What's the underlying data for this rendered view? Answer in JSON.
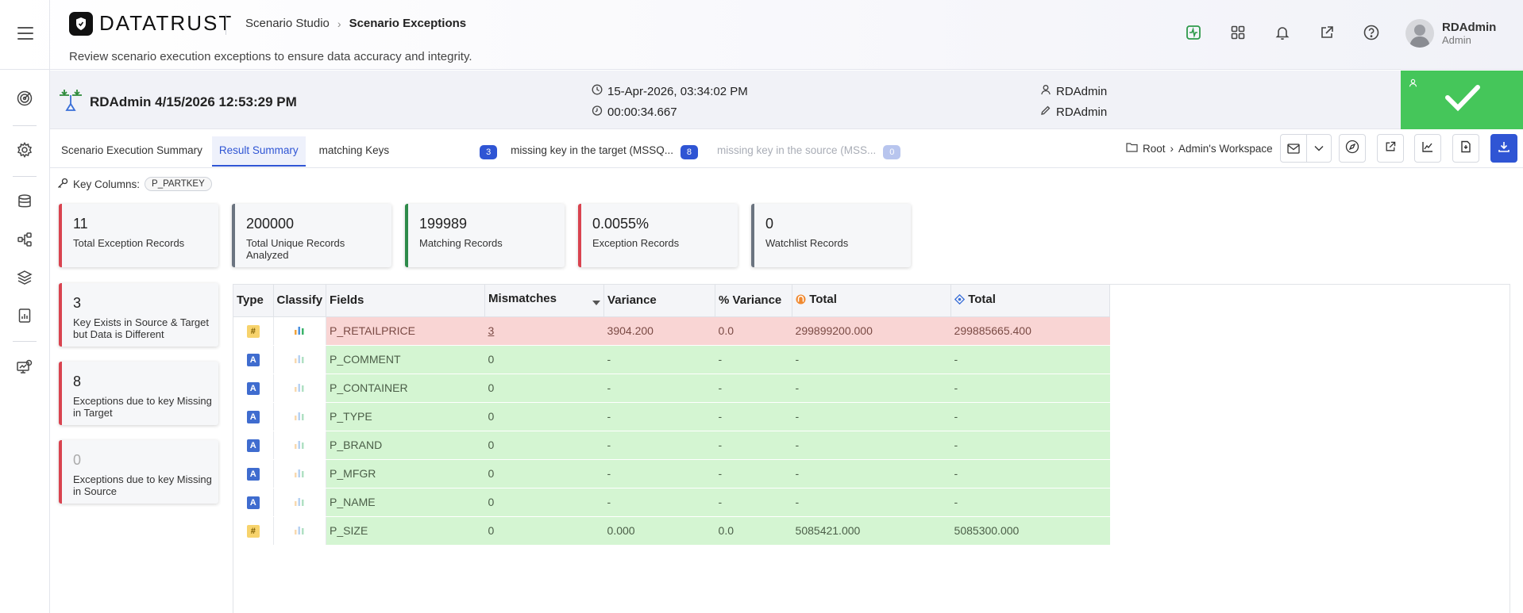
{
  "header": {
    "logo_text": "DATATRUST",
    "breadcrumb": [
      "Scenario Studio",
      "Scenario Exceptions"
    ],
    "subtitle": "Review scenario execution exceptions to ensure data accuracy and integrity.",
    "icons": [
      "activity-icon",
      "apps-grid-icon",
      "bell-icon",
      "external-link-icon",
      "help-icon"
    ],
    "user": {
      "name": "RDAdmin",
      "role": "Admin"
    }
  },
  "sidebar": {
    "icons": [
      "target-icon",
      "settings-icon",
      "database-icon",
      "workflow-icon",
      "layers-icon",
      "report-icon",
      "monitor-settings-icon"
    ]
  },
  "scenario": {
    "title": "RDAdmin 4/15/2026 12:53:29 PM",
    "run_datetime": "15-Apr-2026, 03:34:02 PM",
    "duration": "00:00:34.667",
    "owner": "RDAdmin",
    "editor": "RDAdmin",
    "status": "success"
  },
  "tabs": {
    "summary": "Scenario Execution Summary",
    "result": "Result Summary",
    "matching": "matching Keys",
    "matching_count": "3",
    "missing_target": "missing key in the target (MSSQ...",
    "missing_target_count": "8",
    "missing_source": "missing key in the source (MSS...",
    "missing_source_count": "0"
  },
  "path": {
    "root": "Root",
    "workspace": "Admin's Workspace"
  },
  "key_columns": {
    "label": "Key Columns:",
    "value": "P_PARTKEY"
  },
  "stats": [
    {
      "value": "11",
      "label": "Total Exception Records"
    },
    {
      "value": "200000",
      "label": "Total Unique Records Analyzed"
    },
    {
      "value": "199989",
      "label": "Matching Records"
    },
    {
      "value": "0.0055%",
      "label": "Exception Records"
    },
    {
      "value": "0",
      "label": "Watchlist Records"
    }
  ],
  "side_stats": [
    {
      "value": "3",
      "label": "Key Exists in Source & Target but Data is Different"
    },
    {
      "value": "8",
      "label": "Exceptions due to key Missing in Target"
    },
    {
      "value": "0",
      "label": "Exceptions due to key Missing in Source"
    }
  ],
  "table": {
    "columns": [
      "Type",
      "Classify",
      "Fields",
      "Mismatches",
      "Variance",
      "% Variance",
      "Total",
      "Total"
    ],
    "rows": [
      {
        "type": "#",
        "field": "P_RETAILPRICE",
        "mismatches": "3",
        "variance": "3904.200",
        "pct": "0.0",
        "total_src": "299899200.000",
        "total_tgt": "299885665.400",
        "status": "error"
      },
      {
        "type": "A",
        "field": "P_COMMENT",
        "mismatches": "0",
        "variance": "-",
        "pct": "-",
        "total_src": "-",
        "total_tgt": "-",
        "status": "ok"
      },
      {
        "type": "A",
        "field": "P_CONTAINER",
        "mismatches": "0",
        "variance": "-",
        "pct": "-",
        "total_src": "-",
        "total_tgt": "-",
        "status": "ok"
      },
      {
        "type": "A",
        "field": "P_TYPE",
        "mismatches": "0",
        "variance": "-",
        "pct": "-",
        "total_src": "-",
        "total_tgt": "-",
        "status": "ok"
      },
      {
        "type": "A",
        "field": "P_BRAND",
        "mismatches": "0",
        "variance": "-",
        "pct": "-",
        "total_src": "-",
        "total_tgt": "-",
        "status": "ok"
      },
      {
        "type": "A",
        "field": "P_MFGR",
        "mismatches": "0",
        "variance": "-",
        "pct": "-",
        "total_src": "-",
        "total_tgt": "-",
        "status": "ok"
      },
      {
        "type": "A",
        "field": "P_NAME",
        "mismatches": "0",
        "variance": "-",
        "pct": "-",
        "total_src": "-",
        "total_tgt": "-",
        "status": "ok"
      },
      {
        "type": "#",
        "field": "P_SIZE",
        "mismatches": "0",
        "variance": "0.000",
        "pct": "0.0",
        "total_src": "5085421.000",
        "total_tgt": "5085300.000",
        "status": "ok"
      }
    ]
  },
  "colors": {
    "accent": "#2f55d4",
    "success": "#45c65a",
    "error_row": "#f9d5d4",
    "ok_row": "#d4f5d2",
    "danger_border": "#d9434f"
  }
}
